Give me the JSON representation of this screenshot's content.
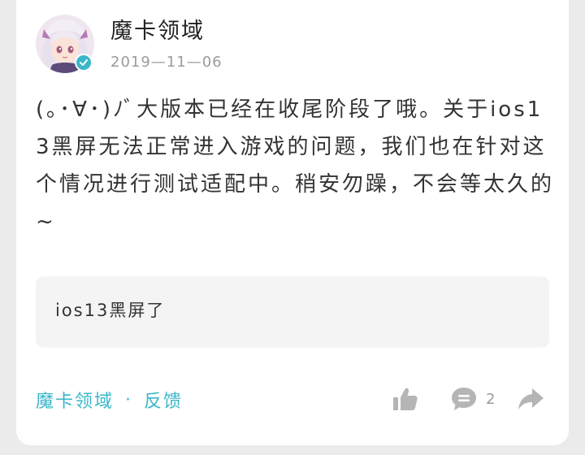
{
  "post": {
    "author": "魔卡领域",
    "date": "2019—11—06",
    "verified": true,
    "body": "(｡･∀･)ﾉﾞ大版本已经在收尾阶段了哦。关于ios13黑屏无法正常进入游戏的问题，我们也在针对这个情况进行测试适配中。稍安勿躁，不会等太久的~",
    "quote": "ios13黑屏了"
  },
  "footer": {
    "source": "魔卡领域",
    "separator": "·",
    "category": "反馈",
    "comment_count": "2"
  },
  "icons": {
    "avatar": "anime-girl-avatar",
    "verified": "verified-check-icon",
    "like": "thumbs-up-icon",
    "comment": "comment-bubble-icon",
    "share": "share-arrow-icon"
  },
  "colors": {
    "accent": "#3ab7c9",
    "icon_gray": "#b5b5b5",
    "quote_bg": "#f4f4f4",
    "page_bg": "#ebebeb"
  }
}
